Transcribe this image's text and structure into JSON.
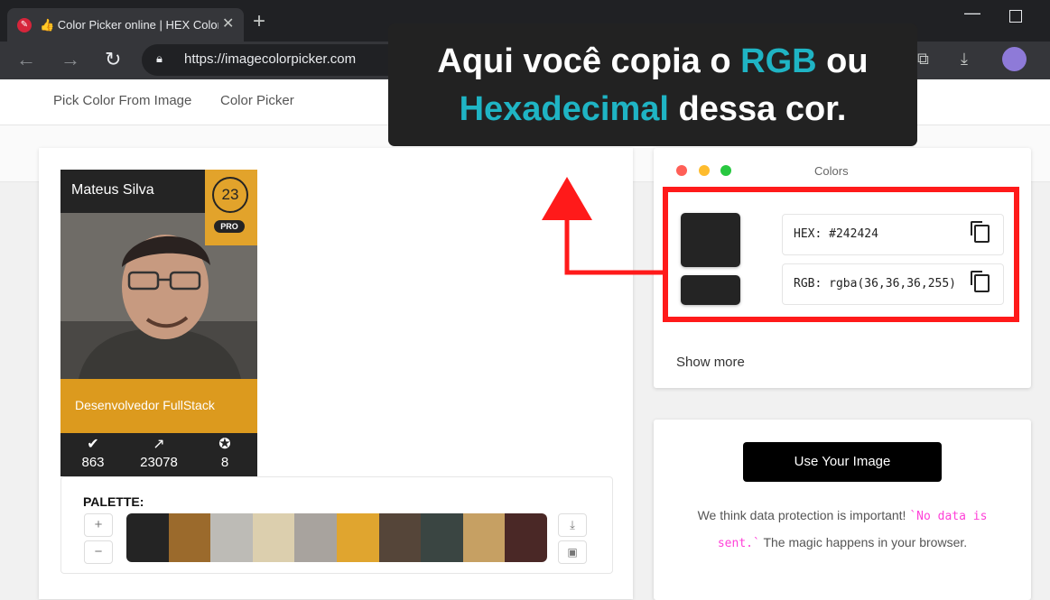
{
  "browser": {
    "tab_title": "👍 Color Picker online | HEX Color Picker",
    "url": "https://imagecolorpicker.com"
  },
  "nav": {
    "pick_from_image": "Pick Color From Image",
    "color_picker": "Color Picker"
  },
  "card": {
    "name": "Mateus Silva",
    "level": "23",
    "badge": "PRO",
    "role": "Desenvolvedor FullStack",
    "stats": [
      "863",
      "23078",
      "8"
    ]
  },
  "palette": {
    "label": "PALETTE:",
    "plus": "+",
    "minus": "−",
    "colors": [
      "#242424",
      "#9b6a2c",
      "#bdbbb6",
      "#dccfae",
      "#a8a39e",
      "#e0a52f",
      "#554539",
      "#3a4542",
      "#c6a063",
      "#4a2826"
    ]
  },
  "colors_panel": {
    "title": "Colors",
    "hex": "HEX: #242424",
    "rgb": "RGB: rgba(36,36,36,255)",
    "show_more": "Show more",
    "selected_color": "#242424"
  },
  "upload": {
    "button": "Use Your Image",
    "privacy_before": "We think data protection is important! ",
    "privacy_code": "`No data is sent.`",
    "privacy_after": " The magic happens in your browser."
  },
  "callout": {
    "line1_a": "Aqui você copia o ",
    "line1_hl": "RGB",
    "line1_b": " ou",
    "line2_hl": "Hexadecimal",
    "line2_b": " dessa cor.",
    "highlight_color": "#1fb4c4",
    "arrow_color": "#ff1a1a"
  }
}
